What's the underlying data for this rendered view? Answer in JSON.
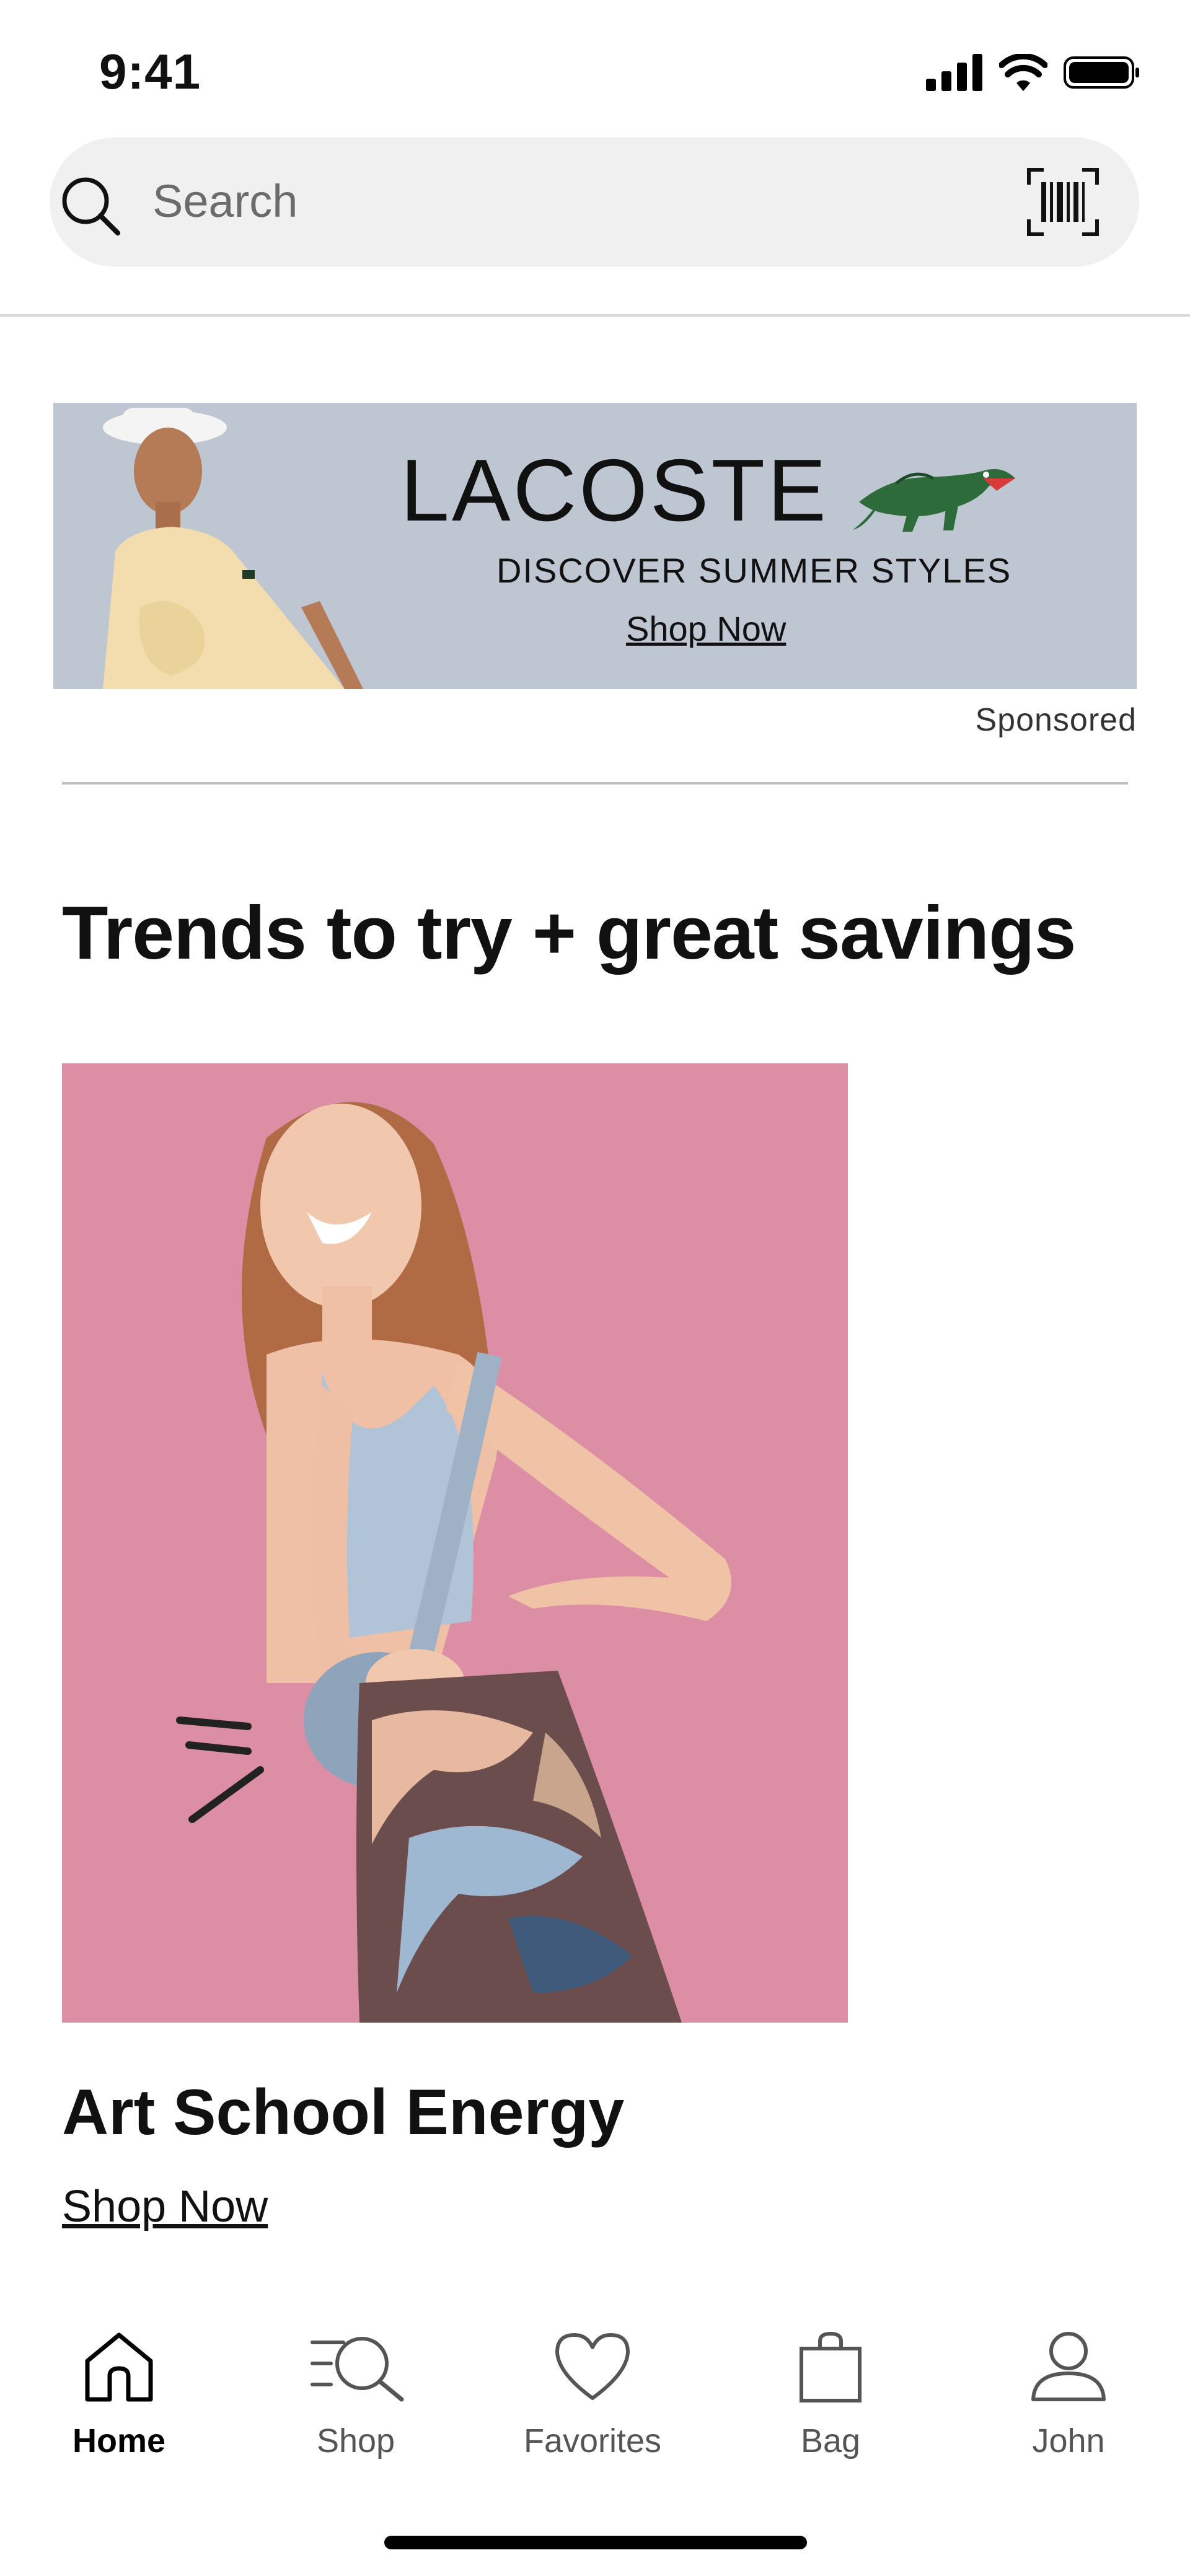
{
  "status_bar": {
    "time": "9:41"
  },
  "search": {
    "placeholder": "Search"
  },
  "ad": {
    "brand": "LACOSTE",
    "tagline": "DISCOVER SUMMER STYLES",
    "cta": "Shop Now",
    "sponsored_label": "Sponsored"
  },
  "section": {
    "title": "Trends to try + great savings",
    "feature": {
      "title": "Art School Energy",
      "cta": "Shop Now"
    }
  },
  "tab_bar": {
    "tabs": [
      {
        "label": "Home",
        "icon": "home-icon",
        "active": true
      },
      {
        "label": "Shop",
        "icon": "shop-search-icon",
        "active": false
      },
      {
        "label": "Favorites",
        "icon": "heart-icon",
        "active": false
      },
      {
        "label": "Bag",
        "icon": "bag-icon",
        "active": false
      },
      {
        "label": "John",
        "icon": "profile-icon",
        "active": false
      }
    ]
  },
  "colors": {
    "ad_background": "#bdc6d1",
    "feature_background": "#dc8fa4",
    "search_background": "#f0f0f0",
    "lacoste_green": "#2e6b3a"
  }
}
